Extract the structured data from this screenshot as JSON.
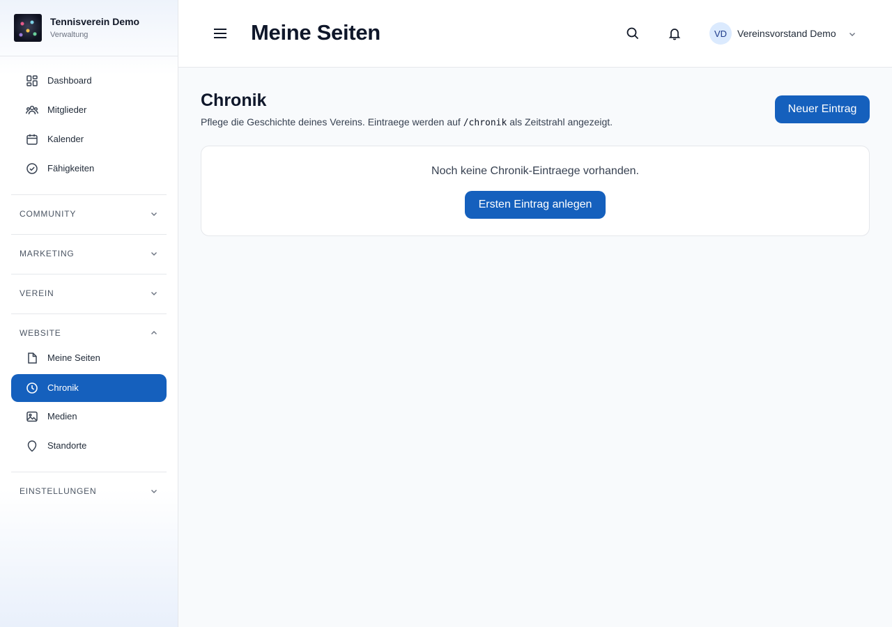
{
  "brand": {
    "name": "Tennisverein Demo",
    "subtitle": "Verwaltung"
  },
  "sidebar": {
    "top_items": [
      {
        "label": "Dashboard",
        "icon": "dashboard-icon"
      },
      {
        "label": "Mitglieder",
        "icon": "users-icon"
      },
      {
        "label": "Kalender",
        "icon": "calendar-icon"
      },
      {
        "label": "Fähigkeiten",
        "icon": "check-circle-icon"
      }
    ],
    "sections": [
      {
        "label": "COMMUNITY",
        "expanded": false
      },
      {
        "label": "MARKETING",
        "expanded": false
      },
      {
        "label": "VEREIN",
        "expanded": false
      },
      {
        "label": "WEBSITE",
        "expanded": true
      },
      {
        "label": "EINSTELLUNGEN",
        "expanded": false
      }
    ],
    "website_items": [
      {
        "label": "Meine Seiten",
        "icon": "document-icon",
        "active": false
      },
      {
        "label": "Chronik",
        "icon": "clock-icon",
        "active": true
      },
      {
        "label": "Medien",
        "icon": "image-icon",
        "active": false
      },
      {
        "label": "Standorte",
        "icon": "location-icon",
        "active": false
      }
    ]
  },
  "header": {
    "title": "Meine Seiten",
    "user": {
      "initials": "VD",
      "name": "Vereinsvorstand Demo"
    }
  },
  "main": {
    "title": "Chronik",
    "description_before": "Pflege die Geschichte deines Vereins. Eintraege werden auf ",
    "description_code": "/chronik",
    "description_after": " als Zeitstrahl angezeigt.",
    "new_button": "Neuer Eintrag",
    "empty_text": "Noch keine Chronik-Eintraege vorhanden.",
    "first_button": "Ersten Eintrag anlegen"
  },
  "colors": {
    "primary": "#1560bd",
    "title": "#0f172a",
    "sidebar_border": "#e5e7eb"
  }
}
